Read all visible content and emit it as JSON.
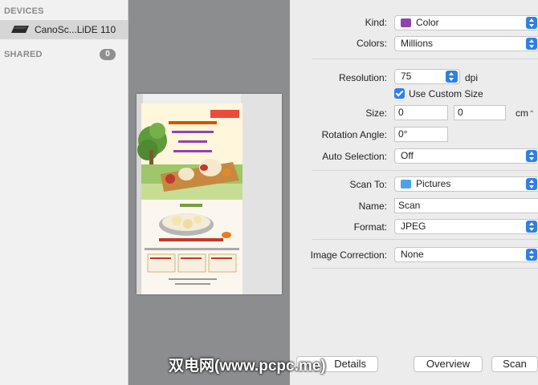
{
  "sidebar": {
    "devices_header": "DEVICES",
    "device_name": "CanoSc...LiDE 110",
    "shared_header": "SHARED",
    "shared_count": "0"
  },
  "settings": {
    "kind_label": "Kind:",
    "kind_value": "Color",
    "colors_label": "Colors:",
    "colors_value": "Millions",
    "resolution_label": "Resolution:",
    "resolution_value": "75",
    "resolution_unit": "dpi",
    "custom_size_label": "Use Custom Size",
    "custom_size_checked": true,
    "size_label": "Size:",
    "size_width": "0",
    "size_height": "0",
    "size_unit": "cm",
    "rotation_label": "Rotation Angle:",
    "rotation_value": "0°",
    "auto_selection_label": "Auto Selection:",
    "auto_selection_value": "Off",
    "scan_to_label": "Scan To:",
    "scan_to_value": "Pictures",
    "name_label": "Name:",
    "name_value": "Scan",
    "format_label": "Format:",
    "format_value": "JPEG",
    "image_correction_label": "Image Correction:",
    "image_correction_value": "None"
  },
  "buttons": {
    "details": "Details",
    "overview": "Overview",
    "scan": "Scan"
  },
  "watermark": "双电网(www.pcpc.me)",
  "colors": {
    "accent": "#2f7fe8",
    "preview_bg": "#8b8d8f",
    "sidebar_selected": "#d6d6d6"
  }
}
